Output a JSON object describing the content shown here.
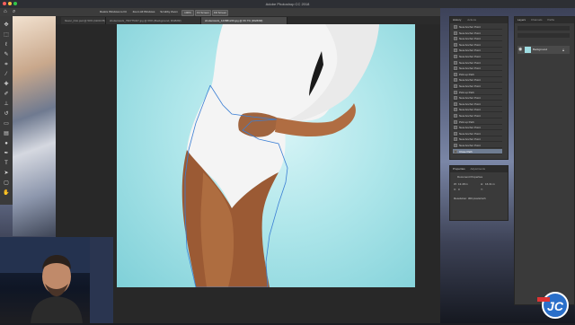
{
  "app": {
    "window_title": "Adobe Photoshop CC 2018"
  },
  "options_bar": {
    "buttons": [
      "Resize Windows to Fit",
      "Zoom All Windows",
      "Scrubby Zoom",
      "100%",
      "Fit Screen",
      "Fill Screen"
    ]
  },
  "tabs": [
    {
      "label": "flower_01A.psd @ 50% (GRAY/8)",
      "active": false
    },
    {
      "label": "shutterstock_796775437.jpg @ 66% (Background, RGB/8#)",
      "active": false
    },
    {
      "label": "shutterstock_123881249.jpg @ 66.7% (RGB/8#)",
      "active": true
    }
  ],
  "history_panel": {
    "tabs": [
      "History",
      "Actions"
    ],
    "items": [
      "New Anchor Point",
      "New Anchor Point",
      "New Anchor Point",
      "New Anchor Point",
      "New Anchor Point",
      "New Anchor Point",
      "New Anchor Point",
      "New Anchor Point",
      "Pick up Path",
      "New Anchor Point",
      "New Anchor Point",
      "Pick up Path",
      "New Anchor Point",
      "New Anchor Point",
      "New Anchor Point",
      "New Anchor Point",
      "Pick up Path",
      "New Anchor Point",
      "New Anchor Point",
      "New Anchor Point",
      "New Anchor Point",
      "Close Path"
    ],
    "selected_index": 21
  },
  "layers_panel": {
    "tabs": [
      "Layers",
      "Channels",
      "Paths"
    ],
    "layers": [
      {
        "name": "Background"
      }
    ]
  },
  "properties_panel": {
    "tabs": [
      "Properties",
      "Adjustments"
    ],
    "title": "Document Properties",
    "fields": [
      {
        "label": "W:",
        "value": "13.48 in"
      },
      {
        "label": "H:",
        "value": "16.31 in"
      },
      {
        "label": "X:",
        "value": "0"
      },
      {
        "label": "Y:",
        "value": ""
      }
    ],
    "resolution": "Resolution: 300 pixels/inch"
  },
  "watermark": {
    "text": "JC"
  },
  "colors": {
    "canvas_bg": "#aee6ea",
    "path_stroke": "#3b7fd4",
    "history_selected": "#6f7d92",
    "panel_bg": "#3a3a3a"
  }
}
